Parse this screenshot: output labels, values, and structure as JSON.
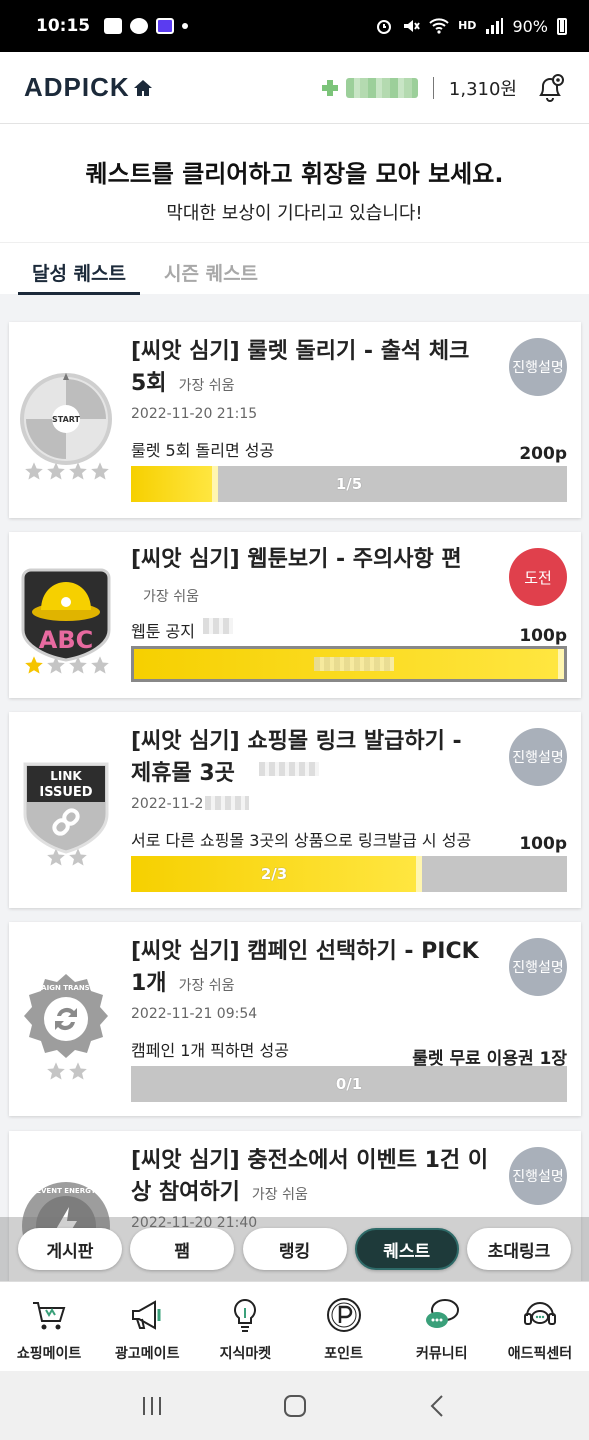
{
  "status_bar": {
    "time": "10:15",
    "battery": "90%",
    "hd_label": "HD"
  },
  "header": {
    "logo": "ADPICK",
    "points": "1,310원"
  },
  "intro": {
    "title": "퀘스트를 클리어하고 휘장을 모아 보세요.",
    "subtitle": "막대한 보상이 기다리고 있습니다!"
  },
  "tabs": [
    {
      "label": "달성 퀘스트",
      "active": true
    },
    {
      "label": "시즌 퀘스트",
      "active": false
    }
  ],
  "quests": [
    {
      "title": "[씨앗 심기] 룰렛 돌리기 - 출석 체크 5회",
      "difficulty": "가장 쉬움",
      "date": "2022-11-20 21:15",
      "desc": "룰렛 5회 돌리면 성공",
      "reward": "200p",
      "progress_text": "1/5",
      "progress": 0.2,
      "button": "진행설명",
      "badge": "roulette-badge",
      "badge_text": "START",
      "stars_filled": 0,
      "stars_total": 4
    },
    {
      "title": "[씨앗 심기] 웹툰보기 - 주의사항 편",
      "difficulty": "가장 쉬움",
      "date": "",
      "desc": "웹툰 공지",
      "reward": "100p",
      "progress_text": "",
      "progress": 1.0,
      "button": "도전",
      "badge": "abc-badge",
      "badge_text": "ABC",
      "stars_filled": 1,
      "stars_total": 4
    },
    {
      "title": "[씨앗 심기] 쇼핑몰 링크 발급하기 - 제휴몰 3곳",
      "difficulty": "",
      "date": "2022-11-2",
      "desc": "서로 다른 쇼핑몰 3곳의 상품으로 링크발급 시 성공",
      "reward": "100p",
      "progress_text": "2/3",
      "progress": 0.667,
      "button": "진행설명",
      "badge": "link-issued-badge",
      "badge_text": "LINK ISSUED",
      "stars_filled": 0,
      "stars_total": 2
    },
    {
      "title": "[씨앗 심기] 캠페인 선택하기 - PICK 1개",
      "difficulty": "가장 쉬움",
      "date": "2022-11-21 09:54",
      "desc": "캠페인 1개 픽하면 성공",
      "reward": "룰렛 무료 이용권 1장",
      "progress_text": "0/1",
      "progress": 0.0,
      "button": "진행설명",
      "badge": "campaign-transform-badge",
      "badge_text": "CAMPAIGN TRANSFORM",
      "stars_filled": 0,
      "stars_total": 2
    },
    {
      "title": "[씨앗 심기] 충전소에서 이벤트 1건 이상 참여하기",
      "difficulty": "가장 쉬움",
      "date": "2022-11-20 21:40",
      "desc": "",
      "reward": "",
      "progress_text": "",
      "progress": 0.0,
      "button": "진행설명",
      "badge": "event-energy-badge",
      "badge_text": "EVENT ENERGY",
      "stars_filled": 0,
      "stars_total": 2
    }
  ],
  "float_nav": [
    {
      "label": "게시판"
    },
    {
      "label": "팸"
    },
    {
      "label": "랭킹"
    },
    {
      "label": "퀘스트",
      "active": true
    },
    {
      "label": "초대링크"
    }
  ],
  "bottom_nav": [
    {
      "label": "쇼핑메이트",
      "icon": "shopping-cart-icon"
    },
    {
      "label": "광고메이트",
      "icon": "megaphone-icon"
    },
    {
      "label": "지식마켓",
      "icon": "lightbulb-icon"
    },
    {
      "label": "포인트",
      "icon": "point-coin-icon"
    },
    {
      "label": "커뮤니티",
      "icon": "chat-bubbles-icon"
    },
    {
      "label": "애드픽센터",
      "icon": "support-agent-icon"
    }
  ],
  "colors": {
    "primary_dark": "#1c2a3a",
    "progress_yellow": "#f6d000",
    "challenge_red": "#e0404c",
    "button_gray": "#a9b0ba"
  }
}
